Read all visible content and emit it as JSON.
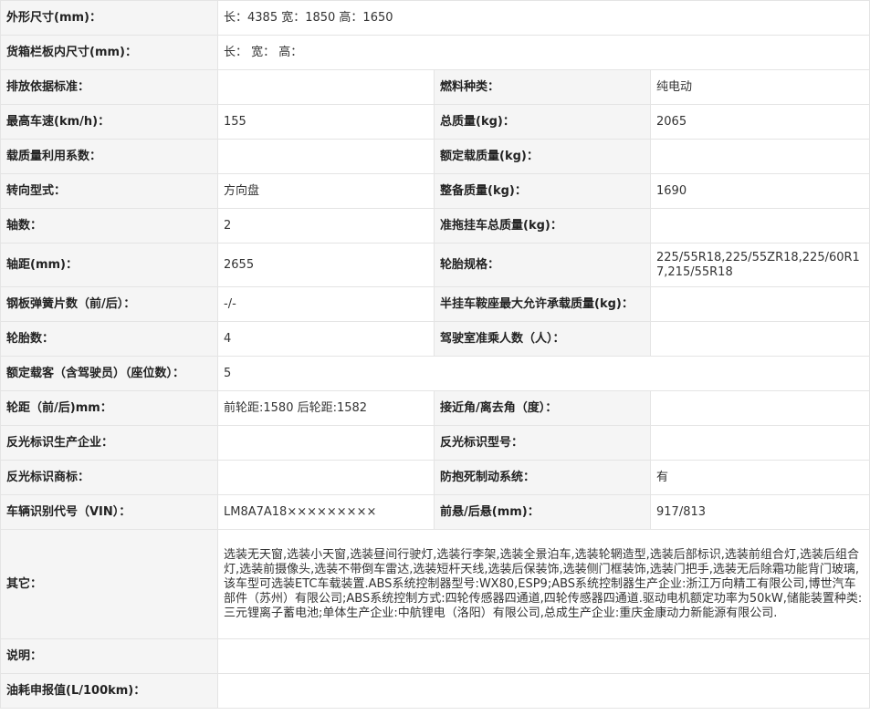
{
  "rows": {
    "dims": {
      "label": "外形尺寸(mm)：",
      "value": "长：4385 宽：1850 高：1650"
    },
    "cargo": {
      "label": "货箱栏板内尺寸(mm)：",
      "value": "长： 宽： 高："
    },
    "emission": {
      "label": "排放依据标准：",
      "value": "",
      "label2": "燃料种类：",
      "value2": "纯电动"
    },
    "speed": {
      "label": "最高车速(km/h)：",
      "value": "155",
      "label2": "总质量(kg)：",
      "value2": "2065"
    },
    "loadcoef": {
      "label": "载质量利用系数：",
      "value": "",
      "label2": "额定载质量(kg)：",
      "value2": ""
    },
    "steering": {
      "label": "转向型式：",
      "value": "方向盘",
      "label2": "整备质量(kg)：",
      "value2": "1690"
    },
    "axles": {
      "label": "轴数：",
      "value": "2",
      "label2": "准拖挂车总质量(kg)：",
      "value2": ""
    },
    "wheelbase": {
      "label": "轴距(mm)：",
      "value": "2655",
      "label2": "轮胎规格：",
      "value2": "225/55R18,225/55ZR18,225/60R17,215/55R18"
    },
    "springs": {
      "label": "钢板弹簧片数（前/后）：",
      "value": "-/-",
      "label2": "半挂车鞍座最大允许承载质量(kg)：",
      "value2": ""
    },
    "tires": {
      "label": "轮胎数：",
      "value": "4",
      "label2": "驾驶室准乘人数（人）：",
      "value2": ""
    },
    "seats": {
      "label": "额定载客（含驾驶员）（座位数）：",
      "value": "5"
    },
    "track": {
      "label": "轮距（前/后)mm：",
      "value": "前轮距:1580 后轮距:1582",
      "label2": "接近角/离去角（度）：",
      "value2": ""
    },
    "reflector_maker": {
      "label": "反光标识生产企业：",
      "value": "",
      "label2": "反光标识型号：",
      "value2": ""
    },
    "reflector_brand": {
      "label": "反光标识商标：",
      "value": "",
      "label2": "防抱死制动系统：",
      "value2": "有"
    },
    "vin": {
      "label": "车辆识别代号（VIN）：",
      "value": "LM8A7A18×××××××××",
      "label2": "前悬/后悬(mm)：",
      "value2": "917/813"
    },
    "other": {
      "label": "其它：",
      "value": "选装无天窗,选装小天窗,选装昼间行驶灯,选装行李架,选装全景泊车,选装轮辋造型,选装后部标识,选装前组合灯,选装后组合灯,选装前摄像头,选装不带倒车雷达,选装短杆天线,选装后保装饰,选装侧门框装饰,选装门把手,选装无后除霜功能背门玻璃,该车型可选装ETC车载装置.ABS系统控制器型号:WX80,ESP9;ABS系统控制器生产企业:浙江万向精工有限公司,博世汽车部件（苏州）有限公司;ABS系统控制方式:四轮传感器四通道,四轮传感器四通道.驱动电机额定功率为50kW,储能装置种类:三元锂离子蓄电池;单体生产企业:中航锂电（洛阳）有限公司,总成生产企业:重庆金康动力新能源有限公司."
    },
    "notes": {
      "label": "说明：",
      "value": ""
    },
    "fuel": {
      "label": "油耗申报值(L/100km)：",
      "value": ""
    }
  }
}
